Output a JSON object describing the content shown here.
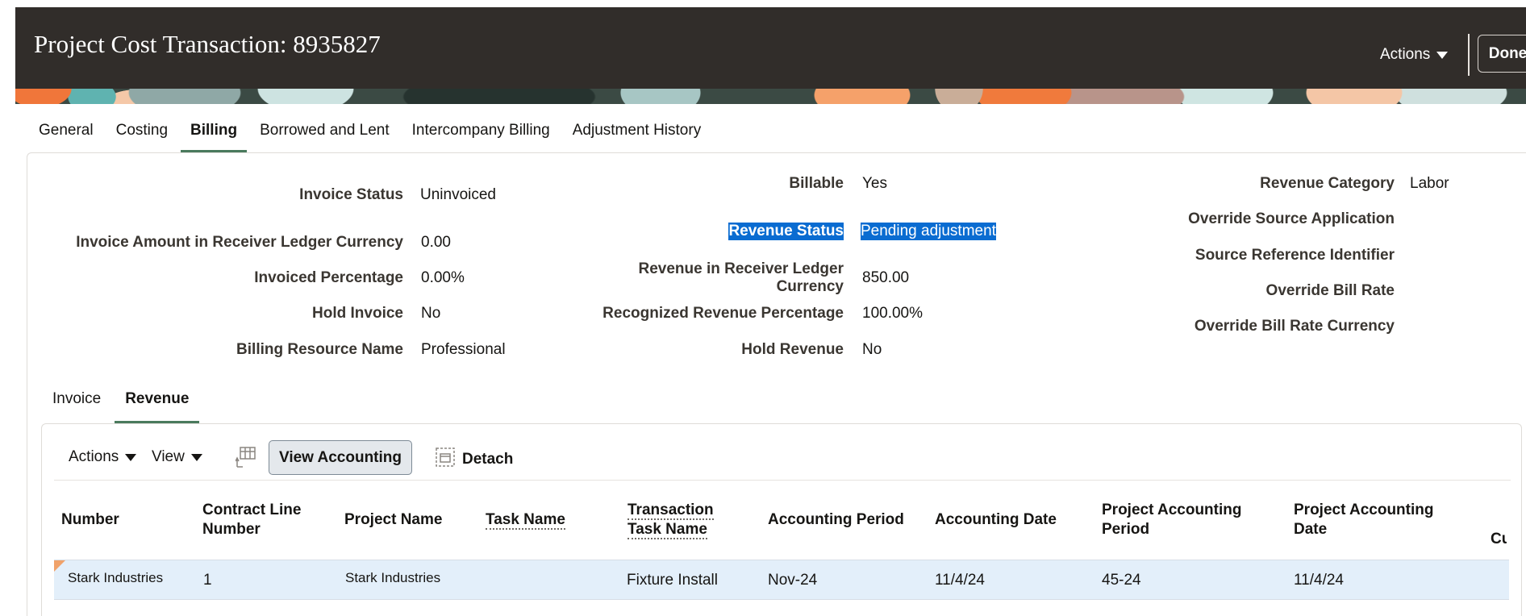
{
  "header": {
    "title": "Project Cost Transaction: 8935827",
    "actions_label": "Actions",
    "done_label": "Done"
  },
  "tabs": [
    {
      "label": "General",
      "active": false
    },
    {
      "label": "Costing",
      "active": false
    },
    {
      "label": "Billing",
      "active": true
    },
    {
      "label": "Borrowed and Lent",
      "active": false
    },
    {
      "label": "Intercompany Billing",
      "active": false
    },
    {
      "label": "Adjustment History",
      "active": false
    }
  ],
  "billing": {
    "left": [
      {
        "label": "Invoice Status",
        "value": "Uninvoiced"
      },
      {
        "label": "Invoice Amount in Receiver Ledger Currency",
        "value": "0.00"
      },
      {
        "label": "Invoiced Percentage",
        "value": "0.00%"
      },
      {
        "label": "Hold Invoice",
        "value": "No"
      },
      {
        "label": "Billing Resource Name",
        "value": "Professional"
      }
    ],
    "middle": [
      {
        "label": "Billable",
        "value": "Yes"
      },
      {
        "label": "Revenue Status",
        "value": "Pending adjustment"
      },
      {
        "label": "Revenue in Receiver Ledger Currency",
        "value": "850.00"
      },
      {
        "label": "Recognized Revenue Percentage",
        "value": "100.00%"
      },
      {
        "label": "Hold Revenue",
        "value": "No"
      }
    ],
    "right": [
      {
        "label": "Revenue Category",
        "value": "Labor"
      },
      {
        "label": "Override Source Application",
        "value": ""
      },
      {
        "label": "Source Reference Identifier",
        "value": ""
      },
      {
        "label": "Override Bill Rate",
        "value": ""
      },
      {
        "label": "Override Bill Rate Currency",
        "value": ""
      }
    ]
  },
  "subtabs": [
    {
      "label": "Invoice",
      "active": false
    },
    {
      "label": "Revenue",
      "active": true
    }
  ],
  "toolbar": {
    "actions_label": "Actions",
    "view_label": "View",
    "view_accounting_label": "View Accounting",
    "detach_label": "Detach"
  },
  "table": {
    "columns": [
      "Number",
      "Contract Line Number",
      "Project Name",
      "Task Name",
      "Transaction Task Name",
      "Accounting Period",
      "Accounting Date",
      "Project Accounting Period",
      "Project Accounting Date",
      "Cu"
    ],
    "rows": [
      {
        "number": "Stark Industries",
        "contract_line_number": "1",
        "project_name": "Stark Industries",
        "task_name": "",
        "transaction_task_name": "Fixture Install",
        "accounting_period": "Nov-24",
        "accounting_date": "11/4/24",
        "project_accounting_period": "45-24",
        "project_accounting_date": "11/4/24"
      }
    ]
  }
}
